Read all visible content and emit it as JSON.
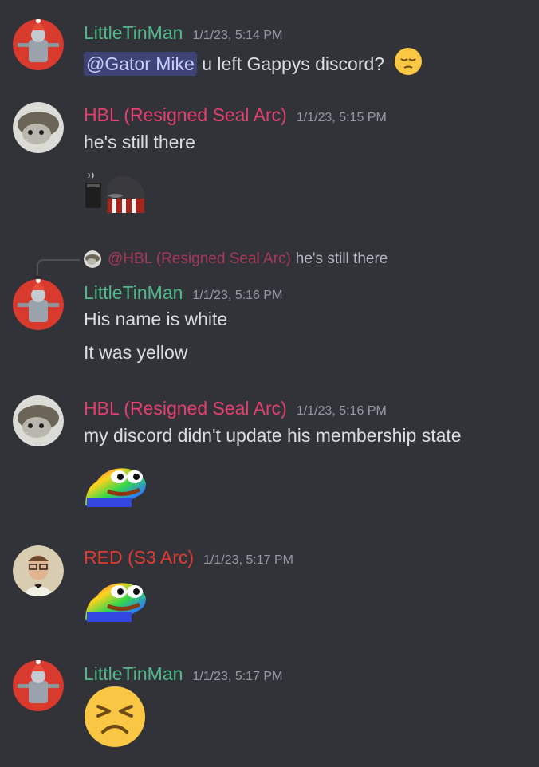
{
  "colors": {
    "background": "#313338",
    "little_tin_man": "#4fb98a",
    "hbl": "#e43f6f",
    "red": "#e03c31",
    "timestamp": "#949ba4"
  },
  "messages": [
    {
      "author": "LittleTinMan",
      "timestamp": "1/1/23, 5:14 PM",
      "mention": "@Gator Mike",
      "text": "u left Gappys discord?",
      "emoji": "pensive-face-icon"
    },
    {
      "author": "HBL (Resigned Seal Arc)",
      "timestamp": "1/1/23, 5:15 PM",
      "text": "he's still there",
      "emoji": "coffee-seal-icon"
    },
    {
      "reply": {
        "mention": "@HBL (Resigned Seal Arc)",
        "text": "he's still there"
      },
      "author": "LittleTinMan",
      "timestamp": "1/1/23, 5:16 PM",
      "lines": [
        "His name is white",
        "It was yellow"
      ]
    },
    {
      "author": "HBL (Resigned Seal Arc)",
      "timestamp": "1/1/23, 5:16 PM",
      "text": "my discord didn't update his membership state",
      "emoji": "rainbow-pepe-icon"
    },
    {
      "author": "RED (S3 Arc)",
      "timestamp": "1/1/23, 5:17 PM",
      "emoji": "rainbow-pepe-icon"
    },
    {
      "author": "LittleTinMan",
      "timestamp": "1/1/23, 5:17 PM",
      "emoji": "persevering-face-icon"
    }
  ]
}
